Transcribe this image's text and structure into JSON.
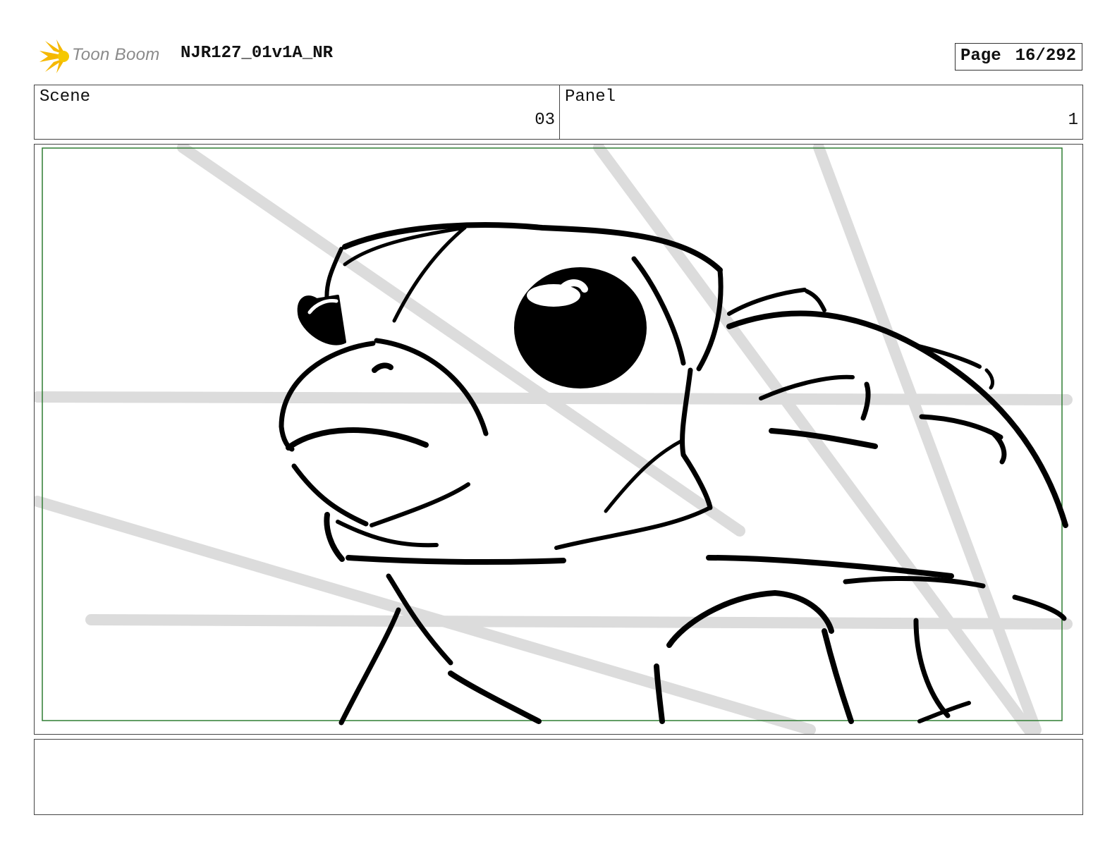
{
  "header": {
    "logo_text": "Toon Boom",
    "title": "NJR127_01v1A_NR",
    "page_label": "Page",
    "page_number": "16/292"
  },
  "scene": {
    "label": "Scene",
    "value": "03"
  },
  "panel": {
    "label": "Panel",
    "value": "1"
  },
  "notes": {
    "text": ""
  },
  "colors": {
    "frame_safe_area": "#2e7d32",
    "logo_accent": "#f5b800",
    "sketch_lines": "#000000",
    "guide_lines": "#dcdcdc"
  }
}
